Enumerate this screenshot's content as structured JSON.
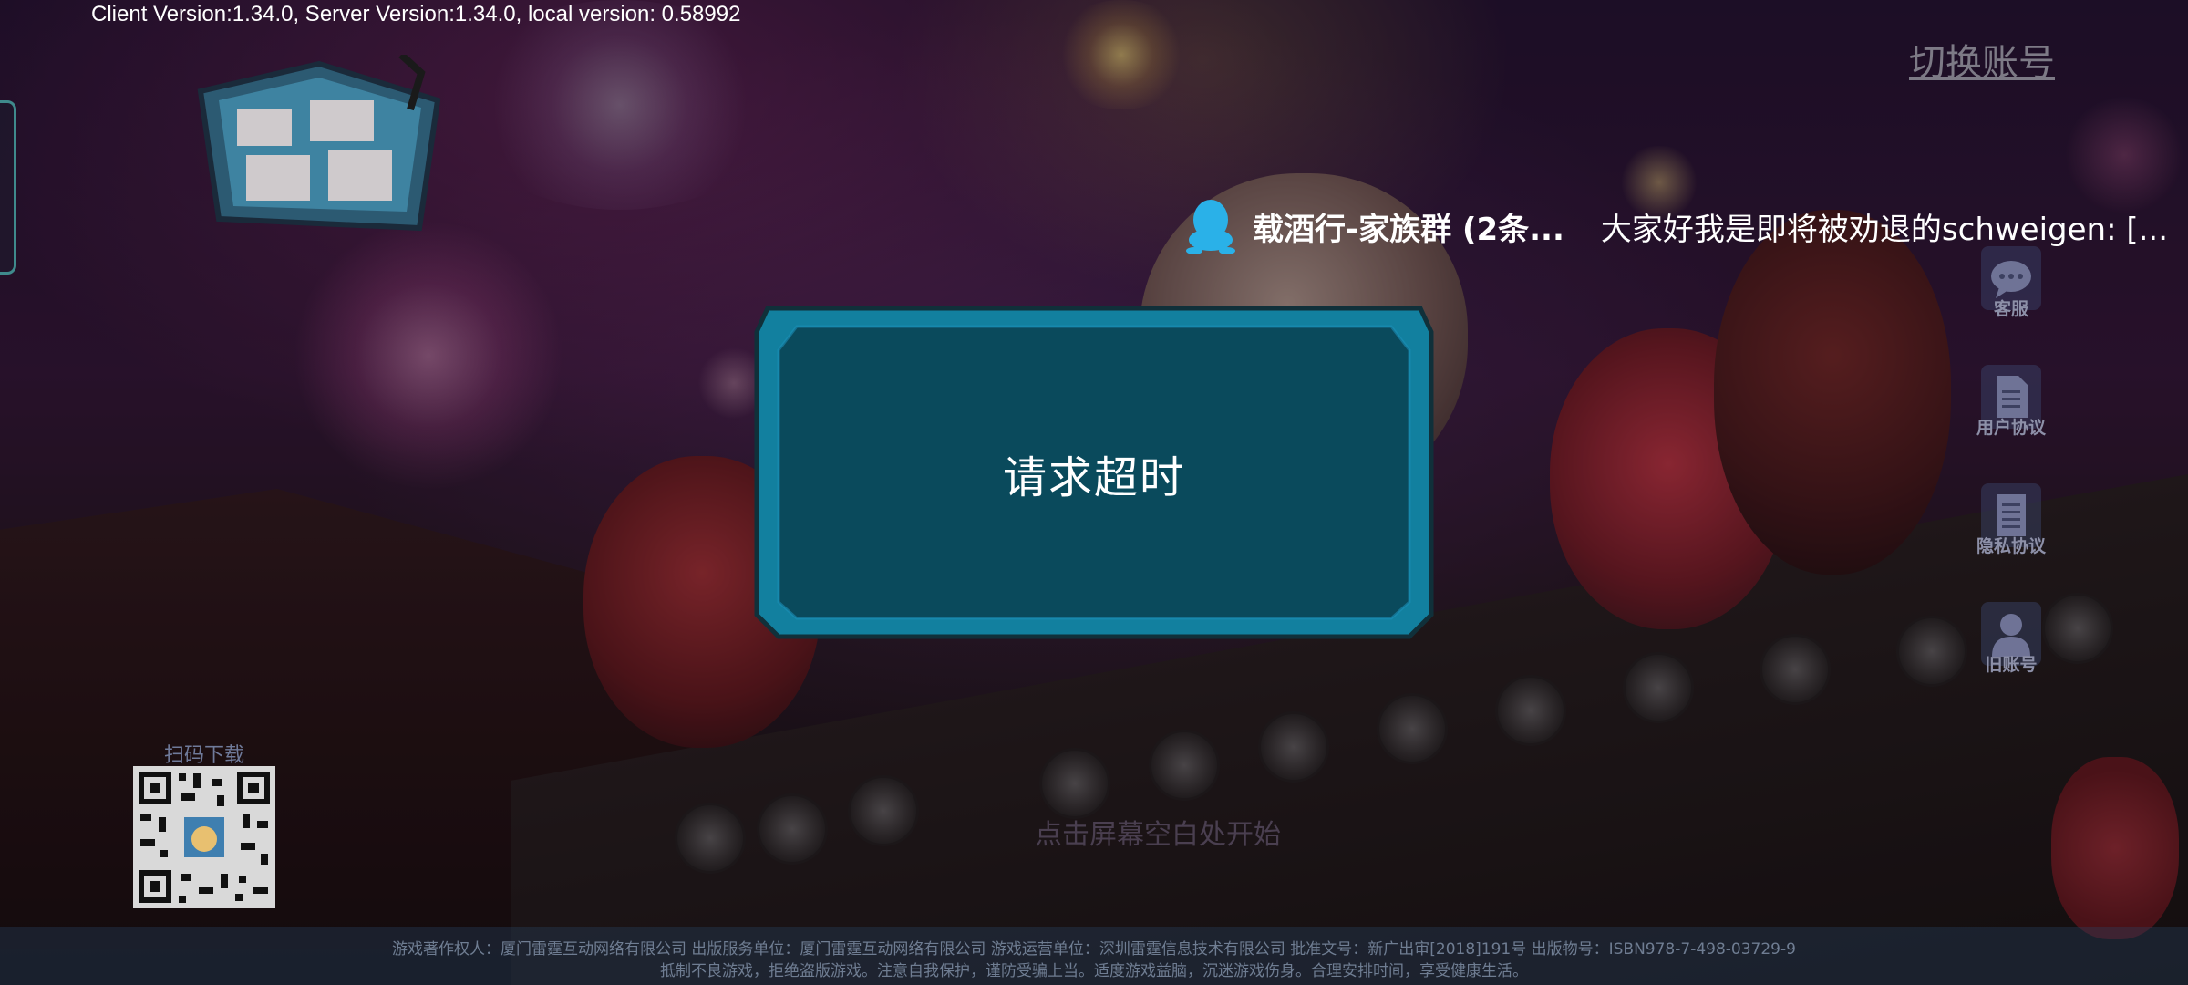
{
  "version_info": "Client Version:1.34.0, Server Version:1.34.0, local version: 0.58992",
  "header": {
    "switch_account_label": "切换账号"
  },
  "notification": {
    "icon": "qq-penguin-icon",
    "group_name": "载酒行-家族群 (2条...",
    "message": "大家好我是即将被劝退的schweigen: [..."
  },
  "side_menu": [
    {
      "icon": "chat-bubble-icon",
      "label": "客服"
    },
    {
      "icon": "document-icon",
      "label": "用户协议"
    },
    {
      "icon": "document-icon",
      "label": "隐私协议"
    },
    {
      "icon": "user-icon",
      "label": "旧账号"
    }
  ],
  "dialog": {
    "message": "请求超时"
  },
  "qr_section": {
    "label": "扫码下载"
  },
  "tap_to_start": "点击屏幕空白处开始",
  "footer": {
    "line1": "游戏著作权人：厦门雷霆互动网络有限公司  出版服务单位：厦门雷霆互动网络有限公司      游戏运营单位：深圳雷霆信息技术有限公司      批准文号：新广出审[2018]191号  出版物号：ISBN978-7-498-03729-9",
    "line2": "抵制不良游戏，拒绝盗版游戏。注意自我保护，谨防受骗上当。适度游戏益脑，沉迷游戏伤身。合理安排时间，享受健康生活。"
  },
  "colors": {
    "dialog_border": "#1b8fb8",
    "dialog_fill": "#0a4a5c",
    "qq_blue": "#2ab1e8"
  }
}
